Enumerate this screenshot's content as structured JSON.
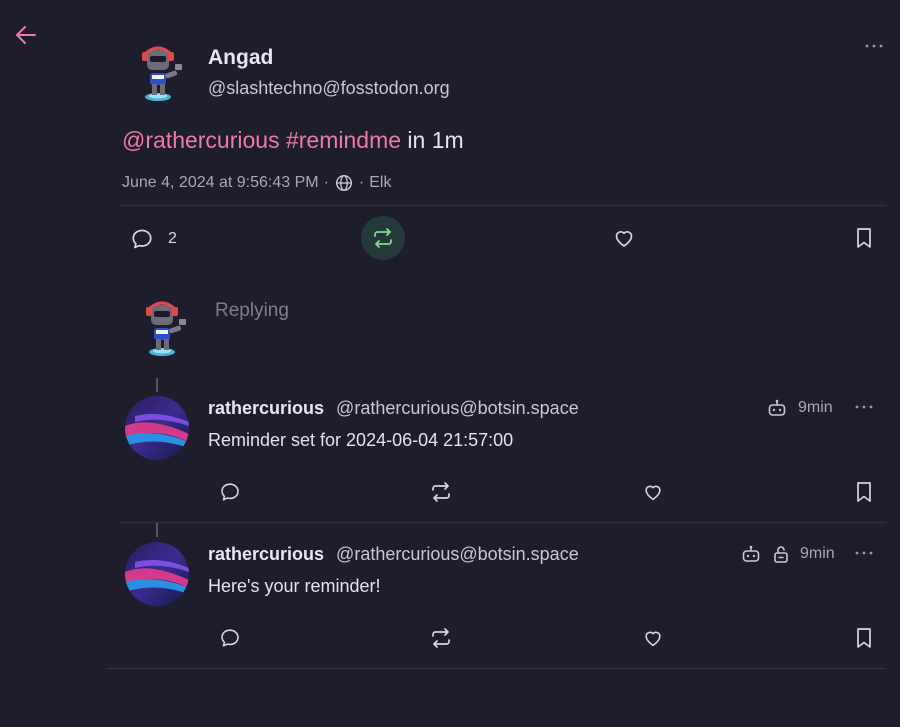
{
  "main_post": {
    "display_name": "Angad",
    "handle": "@slashtechno@fosstodon.org",
    "content": {
      "mention": "@rathercurious",
      "hashtag": "#remindme",
      "rest": " in 1m"
    },
    "timestamp": "June 4, 2024 at 9:56:43 PM",
    "separator1": "·",
    "separator2": "·",
    "client": "Elk",
    "reply_count": "2",
    "boosted": true
  },
  "reply_compose": {
    "placeholder": "Replying"
  },
  "replies": [
    {
      "display_name": "rathercurious",
      "handle": "@rathercurious@botsin.space",
      "time": "9min",
      "content": "Reminder set for 2024-06-04 21:57:00",
      "is_bot": true,
      "unlisted": false
    },
    {
      "display_name": "rathercurious",
      "handle": "@rathercurious@botsin.space",
      "time": "9min",
      "content": "Here's your reminder!",
      "is_bot": true,
      "unlisted": true
    }
  ],
  "colors": {
    "background": "#1e1d2b",
    "accent": "#ee7aa6",
    "boost_active": "#7fdc8f"
  }
}
